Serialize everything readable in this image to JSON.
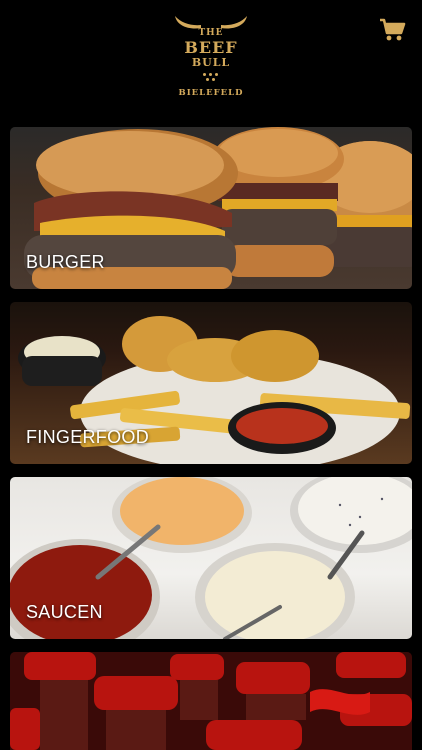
{
  "header": {
    "logo": {
      "line1": "THE",
      "line2": "BEEF",
      "line3": "BULL",
      "city": "BIELEFELD",
      "icon": "bull-horns-icon",
      "color": "#d4aa5c"
    },
    "cart_icon": "shopping-cart-icon"
  },
  "categories": [
    {
      "label": "BURGER"
    },
    {
      "label": "FINGERFOOD"
    },
    {
      "label": "SAUCEN"
    },
    {
      "label": "",
      "icon": "cola-bottles-image"
    }
  ]
}
